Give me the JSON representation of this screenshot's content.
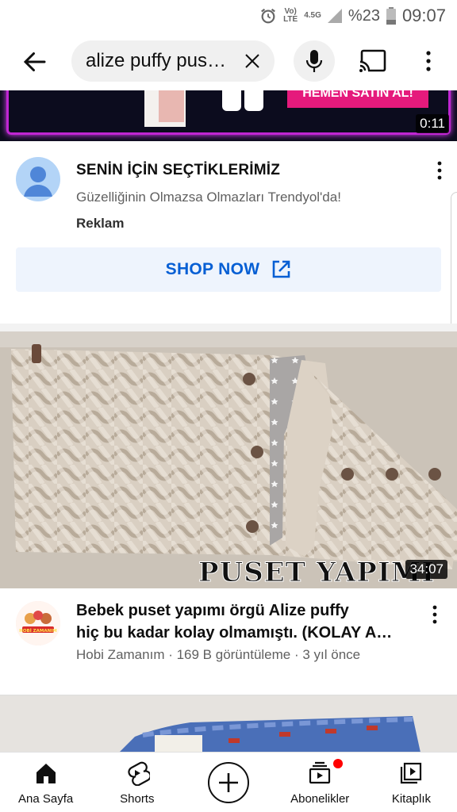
{
  "status_bar": {
    "net_top": "Vo)",
    "net_bottom": "LTE",
    "net_gen": "4.5G",
    "battery": "%23",
    "time": "09:07"
  },
  "search": {
    "query": "alize puffy pus…"
  },
  "ad": {
    "video_banner_text": "HEMEN SATIN AL!",
    "video_duration": "0:11",
    "title": "SENİN İÇİN SEÇTİKLERİMİZ",
    "subtitle": "Güzelliğinin Olmazsa Olmazları Trendyol'da!",
    "label": "Reklam",
    "cta": "SHOP NOW"
  },
  "video": {
    "thumbnail_caption": "PUSET YAPIMI",
    "duration": "34:07",
    "title_line1": "Bebek puset yapımı örgü Alize puffy",
    "title_line2": "hiç bu kadar kolay olmamıştı. (KOLAY A…",
    "meta": "Hobi Zamanım · 169 B görüntüleme · 3 yıl önce",
    "channel_avatar_text": "HOBİ ZAMANIM"
  },
  "nav": {
    "home": "Ana Sayfa",
    "shorts": "Shorts",
    "subscriptions": "Abonelikler",
    "library": "Kitaplık"
  },
  "colors": {
    "accent_blue": "#065fd4",
    "brand_red": "#ff0000",
    "ad_magenta": "#e51a7c"
  }
}
